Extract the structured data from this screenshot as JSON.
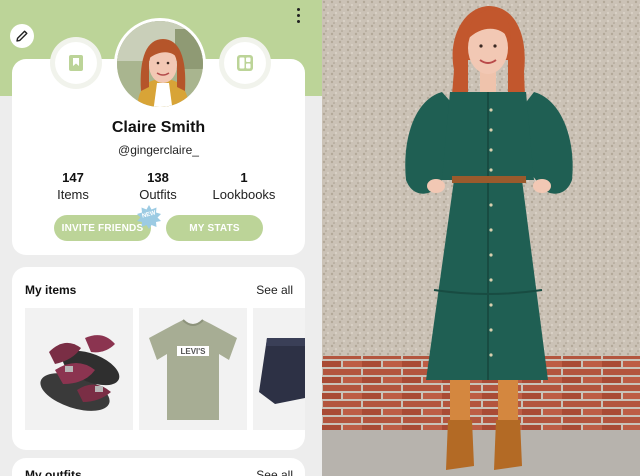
{
  "profile": {
    "name": "Claire Smith",
    "handle": "@gingerclaire_",
    "stats": [
      {
        "value": "147",
        "label": "Items"
      },
      {
        "value": "138",
        "label": "Outfits"
      },
      {
        "value": "1",
        "label": "Lookbooks"
      }
    ],
    "invite_label": "INVITE FRIENDS",
    "new_badge": "NEW",
    "stats_label": "MY STATS"
  },
  "sections": {
    "items": {
      "title": "My items",
      "see_all": "See all"
    },
    "outfits": {
      "title": "My outfits",
      "see_all": "See all"
    }
  },
  "items": [
    {
      "icon": "sandals-icon"
    },
    {
      "icon": "tshirt-icon",
      "print": "LEVI'S"
    },
    {
      "icon": "shorts-icon"
    }
  ],
  "colors": {
    "accent_green": "#bcd498",
    "badge_blue": "#9ccbe3",
    "dress_green": "#1f5f53"
  },
  "icons": {
    "edit": "pencil-icon",
    "more": "more-vertical-icon",
    "left_action": "bookmark-icon",
    "right_action": "grid-icon"
  }
}
